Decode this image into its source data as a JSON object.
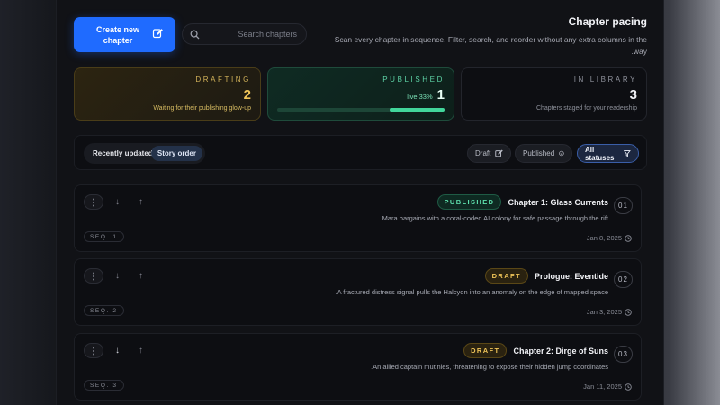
{
  "header": {
    "create_button": "Create new\nchapter",
    "search_placeholder": "Search chapters",
    "title": "Chapter pacing",
    "subtitle": "Scan every chapter in sequence. Filter, search, and reorder without any extra columns in the way."
  },
  "stats": {
    "drafting": {
      "label": "DRAFTING",
      "value": "2",
      "desc": "Waiting for their publishing glow-up"
    },
    "published": {
      "label": "PUBLISHED",
      "live": "live 33%",
      "value": "1",
      "progress": 0.33
    },
    "library": {
      "label": "IN LIBRARY",
      "value": "3",
      "desc": "Chapters staged for your readership"
    }
  },
  "filters": {
    "sort_recent": "Recently updated",
    "sort_story": "Story order",
    "draft": "Draft",
    "published": "Published",
    "all": "All statuses"
  },
  "chapters": [
    {
      "status": "PUBLISHED",
      "status_kind": "pub",
      "title": "Chapter 1: Glass Currents",
      "num": "01",
      "desc": "Mara bargains with a coral-coded AI colony for safe passage through the rift.",
      "seq": "SEQ. 1",
      "date": "Jan 8, 2025"
    },
    {
      "status": "DRAFT",
      "status_kind": "draft",
      "title": "Prologue: Eventide",
      "num": "02",
      "desc": "A fractured distress signal pulls the Halcyon into an anomaly on the edge of mapped space.",
      "seq": "SEQ. 2",
      "date": "Jan 3, 2025"
    },
    {
      "status": "DRAFT",
      "status_kind": "draft",
      "title": "Chapter 2: Dirge of Suns",
      "num": "03",
      "desc": "An allied captain mutinies, threatening to expose their hidden jump coordinates.",
      "seq": "SEQ. 3",
      "date": "Jan 11, 2025"
    }
  ],
  "icons": {
    "create": "edit-icon",
    "search": "search-icon",
    "filter": "filter-icon",
    "clock": "clock-icon",
    "drag": "drag-handle-icon",
    "check": "check-circle-icon"
  },
  "colors": {
    "accent": "#1f6bff",
    "draft": "#f0c559",
    "published": "#42d69b"
  }
}
